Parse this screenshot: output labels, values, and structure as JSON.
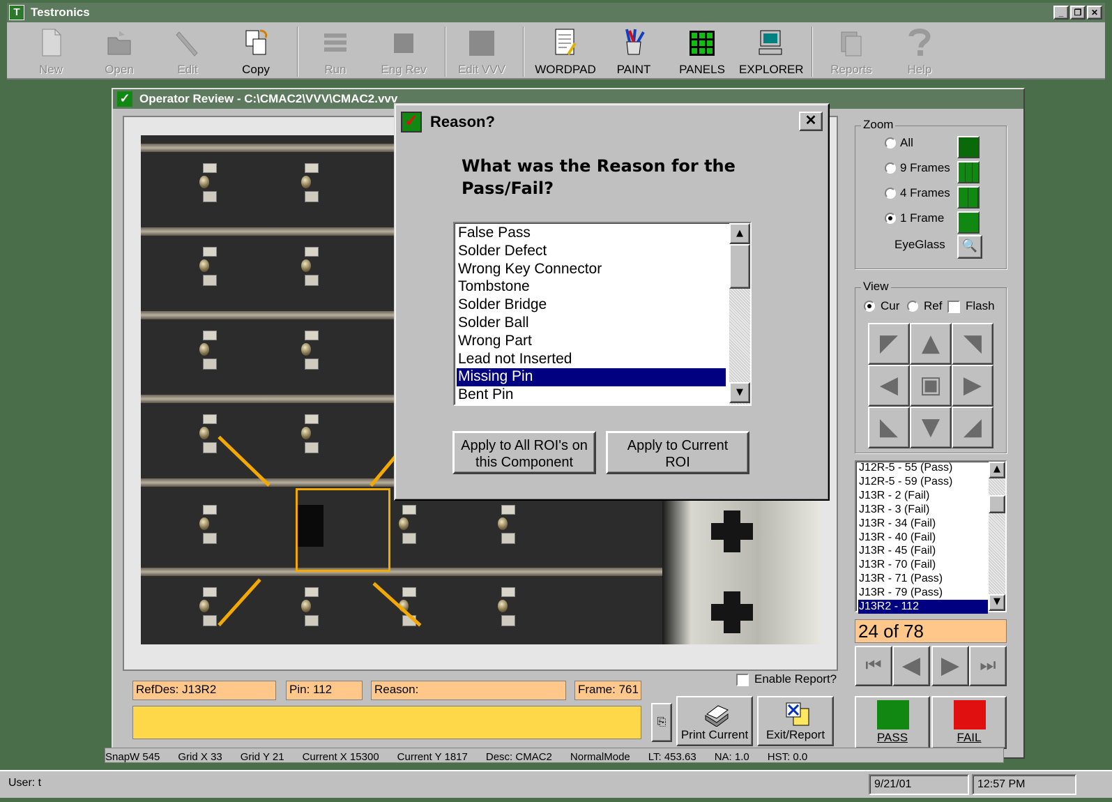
{
  "app": {
    "title": "Testronics",
    "logo_letter": "T"
  },
  "window_buttons": {
    "minimize": "_",
    "restore": "❐",
    "close": "✕"
  },
  "toolbar": [
    {
      "label": "New",
      "icon": "new-document-icon",
      "enabled": false
    },
    {
      "label": "Open",
      "icon": "open-folder-icon",
      "enabled": false
    },
    {
      "label": "Edit",
      "icon": "edit-pen-icon",
      "enabled": false
    },
    {
      "label": "Copy",
      "icon": "copy-icon",
      "enabled": true
    },
    {
      "label": "Run",
      "icon": "run-icon",
      "enabled": false
    },
    {
      "label": "Eng Rev",
      "icon": "engineering-review-icon",
      "enabled": false
    },
    {
      "label": "Edit VVV",
      "icon": "edit-vvv-icon",
      "enabled": false
    },
    {
      "label": "WORDPAD",
      "icon": "wordpad-icon",
      "enabled": true
    },
    {
      "label": "PAINT",
      "icon": "paint-icon",
      "enabled": true
    },
    {
      "label": "PANELS",
      "icon": "panels-icon",
      "enabled": true
    },
    {
      "label": "EXPLORER",
      "icon": "explorer-icon",
      "enabled": true
    },
    {
      "label": "Reports",
      "icon": "reports-icon",
      "enabled": false
    },
    {
      "label": "Help",
      "icon": "help-icon",
      "enabled": false
    }
  ],
  "review_window": {
    "title": "Operator Review - C:\\CMAC2\\VVV\\CMAC2.vvv"
  },
  "dialog": {
    "title": "Reason?",
    "question": "What was the Reason for the Pass/Fail?",
    "reasons": [
      "False Pass",
      "Solder Defect",
      "Wrong Key Connector",
      "Tombstone",
      "Solder Bridge",
      "Solder Ball",
      "Wrong Part",
      "Lead not Inserted",
      "Missing Pin",
      "Bent Pin"
    ],
    "selected_reason": "Missing Pin",
    "apply_all_label": "Apply to All ROI's on this Component",
    "apply_current_label": "Apply to Current ROI"
  },
  "zoom": {
    "label": "Zoom",
    "options": [
      {
        "label": "All",
        "selected": false
      },
      {
        "label": "9 Frames",
        "selected": false
      },
      {
        "label": "4 Frames",
        "selected": false
      },
      {
        "label": "1 Frame",
        "selected": true
      }
    ],
    "eyeglass_label": "EyeGlass"
  },
  "view": {
    "label": "View",
    "cur_label": "Cur",
    "ref_label": "Ref",
    "flash_label": "Flash",
    "selected": "Cur",
    "flash_checked": false
  },
  "roi_list": [
    "J12R-5 - 55  (Pass)",
    "J12R-5 - 59  (Pass)",
    "J13R - 2  (Fail)",
    "J13R - 3  (Fail)",
    "J13R - 34  (Fail)",
    "J13R - 40  (Fail)",
    "J13R - 45  (Fail)",
    "J13R - 70  (Fail)",
    "J13R - 71  (Pass)",
    "J13R - 79  (Pass)",
    "J13R2 - 112"
  ],
  "roi_selected_index": 10,
  "counter": "24 of 78",
  "info": {
    "refdes": "RefDes: J13R2",
    "pin": "Pin: 112",
    "reason": "Reason:",
    "frame": "Frame: 761",
    "comment": ""
  },
  "enable_report": {
    "label": "Enable Report?",
    "checked": false
  },
  "buttons": {
    "print_current": "Print Current",
    "exit_report": "Exit/Report",
    "pass": "PASS",
    "fail": "FAIL"
  },
  "colors": {
    "pass": "#118811",
    "fail": "#e01010",
    "highlight": "#000080",
    "field": "#ffc88a",
    "comment": "#ffd84a",
    "roi": "#f3a900"
  },
  "info_strip": [
    "SnapW 545",
    "Grid X 33",
    "Grid Y 21",
    "Current X 15300",
    "Current Y 1817",
    "Desc: CMAC2",
    "NormalMode",
    "LT: 453.63",
    "NA: 1.0",
    "HST: 0.0"
  ],
  "status": {
    "user": "User: t",
    "date": "9/21/01",
    "time": "12:57 PM"
  }
}
